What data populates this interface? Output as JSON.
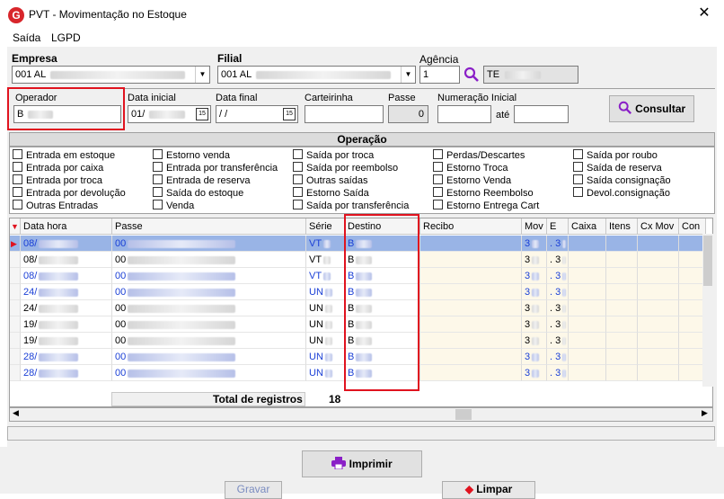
{
  "window": {
    "title": "PVT - Movimentação no Estoque",
    "logo_letter": "G",
    "close_glyph": "✕"
  },
  "menu": [
    {
      "label": "Saída"
    },
    {
      "label": "LGPD"
    }
  ],
  "filters": {
    "empresa": {
      "label": "Empresa",
      "value": "001 AL"
    },
    "filial": {
      "label": "Filial",
      "value": "001 AL"
    },
    "agencia": {
      "label": "Agência",
      "value": "1",
      "code": "TE"
    },
    "operador": {
      "label": "Operador",
      "value": "B"
    },
    "data_inicial": {
      "label": "Data inicial",
      "value": "01/"
    },
    "data_final": {
      "label": "Data final",
      "value": " / /"
    },
    "carteirinha": {
      "label": "Carteirinha",
      "value": ""
    },
    "passe": {
      "label": "Passe",
      "value": "0"
    },
    "numeracao": {
      "label": "Numeração Inicial",
      "value": "",
      "ate_label": "até",
      "ate_value": ""
    },
    "consultar_label": "Consultar"
  },
  "operacao": {
    "title": "Operação",
    "columns": [
      [
        "Entrada em estoque",
        "Entrada por caixa",
        "Entrada por troca",
        "Entrada por devolução",
        "Outras Entradas"
      ],
      [
        "Estorno venda",
        "Entrada por transferência",
        "Entrada de reserva",
        "Saída do estoque",
        "Venda"
      ],
      [
        "Saída por troca",
        "Saída por reembolso",
        "Outras saídas",
        "Estorno Saída",
        "Saída por transferência"
      ],
      [
        "Perdas/Descartes",
        "Estorno Troca",
        "Estorno Venda",
        "Estorno Reembolso",
        "Estorno Entrega Cart"
      ],
      [
        "Saída por roubo",
        "Saída de reserva",
        "Saída consignação",
        "Devol.consignação"
      ]
    ]
  },
  "grid": {
    "headers": [
      "Data hora",
      "Passe",
      "Série",
      "Destino",
      "Recibo",
      "Mov",
      "E",
      "Caixa",
      "Itens",
      "Cx Mov",
      "Con"
    ],
    "rows": [
      {
        "data": "08/",
        "passe": "00",
        "serie": "VT",
        "destino": "B",
        "mov": "3",
        "e": ". 3",
        "blue": true,
        "selected": true
      },
      {
        "data": "08/",
        "passe": "00",
        "serie": "VT",
        "destino": "B",
        "mov": "3",
        "e": ". 3",
        "blue": false,
        "selected": false
      },
      {
        "data": "08/",
        "passe": "00",
        "serie": "VT",
        "destino": "B",
        "mov": "3",
        "e": ". 3",
        "blue": true,
        "selected": false
      },
      {
        "data": "24/",
        "passe": "00",
        "serie": "UN",
        "destino": "B",
        "mov": "3",
        "e": ". 3",
        "blue": true,
        "selected": false
      },
      {
        "data": "24/",
        "passe": "00",
        "serie": "UN",
        "destino": "B",
        "mov": "3",
        "e": ". 3",
        "blue": false,
        "selected": false
      },
      {
        "data": "19/",
        "passe": "00",
        "serie": "UN",
        "destino": "B",
        "mov": "3",
        "e": ". 3",
        "blue": false,
        "selected": false
      },
      {
        "data": "19/",
        "passe": "00",
        "serie": "UN",
        "destino": "B",
        "mov": "3",
        "e": ". 3",
        "blue": false,
        "selected": false
      },
      {
        "data": "28/",
        "passe": "00",
        "serie": "UN",
        "destino": "B",
        "mov": "3",
        "e": ". 3",
        "blue": true,
        "selected": false
      },
      {
        "data": "28/",
        "passe": "00",
        "serie": "UN",
        "destino": "B",
        "mov": "3",
        "e": ". 3",
        "blue": true,
        "selected": false
      }
    ],
    "total_label": "Total de registros",
    "total_value": "18"
  },
  "actions": {
    "imprimir": "Imprimir",
    "gravar": "Gravar",
    "limpar": "Limpar"
  },
  "colors": {
    "highlight": "#e0131f",
    "selected_row": "#99b4e6",
    "link_blue": "#1a3fd6",
    "cream": "#fdf8e9"
  }
}
